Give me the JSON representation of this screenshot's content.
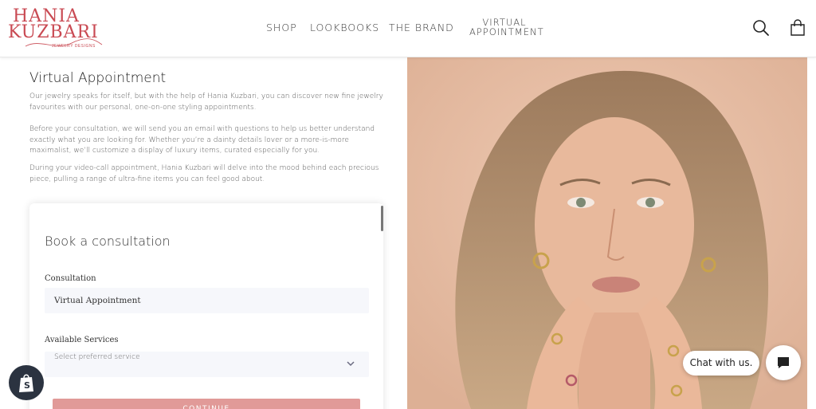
{
  "header": {
    "logo": {
      "line1": "HANIA",
      "line2": "KUZBARI",
      "tagline": "JEWELRY DESIGNS"
    },
    "nav": [
      {
        "label": "SHOP"
      },
      {
        "label": "LOOKBOOKS"
      },
      {
        "label": "THE BRAND"
      },
      {
        "label_line1": "VIRTUAL",
        "label_line2": "APPOINTMENT"
      }
    ],
    "icons": {
      "search": "search-icon",
      "cart": "shopping-bag-icon"
    }
  },
  "intro": {
    "title": "Virtual Appointment",
    "paragraphs": [
      "Our jewelry speaks for itself, but with the help of Hania Kuzbari, you can discover new fine jewelry favourites with our personal, one-on-one styling appointments.",
      "Before your consultation, we will send you an email with questions to help us better understand exactly what you are looking for. Whether you’re a dainty details lover or a more-is-more maximalist, we’ll customize a display of luxury items, curated especially for you.",
      "During your video-call appointment, Hania Kuzbari will delve into the mood behind each precious piece, pulling a range of ultra-fine items you can feel good about."
    ]
  },
  "booking": {
    "title": "Book a consultation",
    "consultation_label": "Consultation",
    "consultation_value": "Virtual Appointment",
    "services_label": "Available Services",
    "services_placeholder": "Select preferred service",
    "continue_label": "CONTINUE"
  },
  "chat": {
    "label": "Chat with us.",
    "icon": "chat-bubble-icon"
  },
  "badge": {
    "icon": "shopify-bag-icon"
  },
  "colors": {
    "brand": "#c94a53",
    "button": "#e19a98",
    "field_bg": "#f6f7fb",
    "hero_bg": "#e6bca3"
  }
}
